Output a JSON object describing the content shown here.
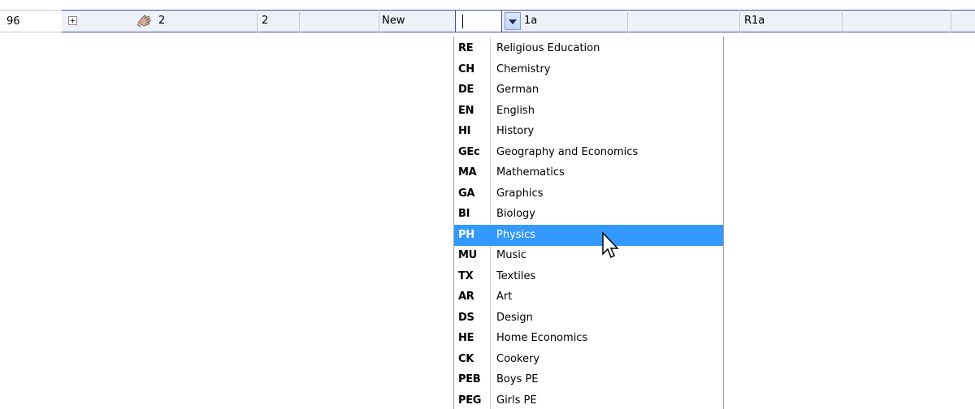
{
  "row": {
    "row_number": "96",
    "c2": "2",
    "c3": "2",
    "c4": "New",
    "c5": "",
    "c6": "1a",
    "c7": "R1a"
  },
  "dropdown": {
    "items": [
      {
        "code": "RE",
        "name": "Religious Education"
      },
      {
        "code": "CH",
        "name": "Chemistry"
      },
      {
        "code": "DE",
        "name": "German"
      },
      {
        "code": "EN",
        "name": "English"
      },
      {
        "code": "HI",
        "name": "History"
      },
      {
        "code": "GEc",
        "name": "Geography and Economics"
      },
      {
        "code": "MA",
        "name": "Mathematics"
      },
      {
        "code": "GA",
        "name": "Graphics"
      },
      {
        "code": "BI",
        "name": "Biology"
      },
      {
        "code": "PH",
        "name": "Physics"
      },
      {
        "code": "MU",
        "name": "Music"
      },
      {
        "code": "TX",
        "name": "Textiles"
      },
      {
        "code": "AR",
        "name": "Art"
      },
      {
        "code": "DS",
        "name": "Design"
      },
      {
        "code": "HE",
        "name": "Home Economics"
      },
      {
        "code": "CK",
        "name": "Cookery"
      },
      {
        "code": "PEB",
        "name": "Boys PE"
      },
      {
        "code": "PEG",
        "name": "Girls PE"
      }
    ],
    "selected_code": "PH"
  },
  "icons": {
    "expander": "plus-expander-icon",
    "row_icon": "hand-pointer-icon",
    "dropdown_button": "chevron-down-icon",
    "cursor": "mouse-pointer-icon"
  },
  "colors": {
    "selection": "#3399ff",
    "row_border": "#3a4fb8",
    "row_background": "#eef1f8"
  }
}
